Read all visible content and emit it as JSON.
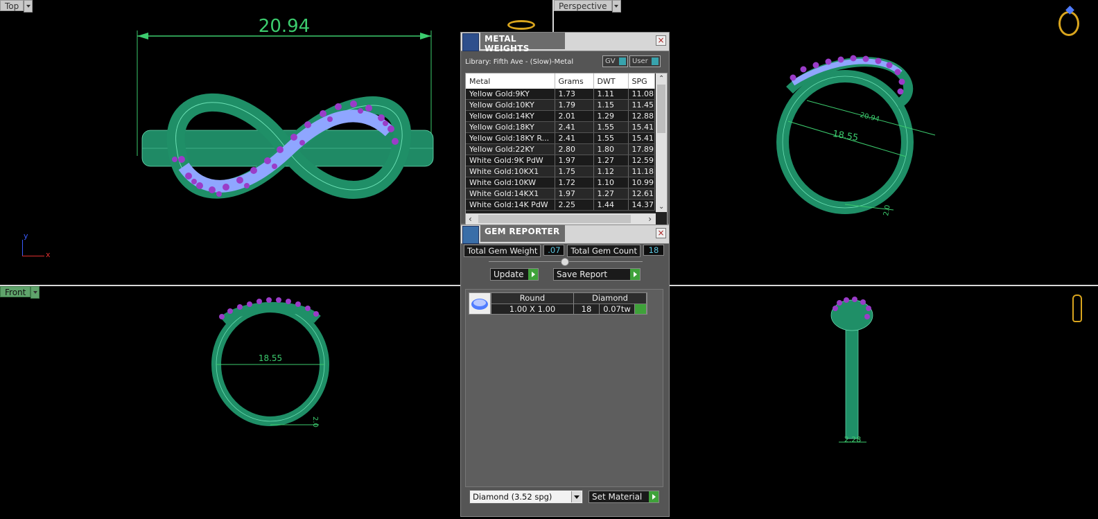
{
  "viewports": {
    "top": {
      "label": "Top",
      "dim_width": "20.94"
    },
    "perspective": {
      "label": "Perspective",
      "dim_width": "20.94",
      "dim_inner": "18.55",
      "dim_small": "2.0"
    },
    "front": {
      "label": "Front",
      "dim_inner": "18.55",
      "dim_small": "2.0"
    },
    "right": {
      "dim_width": "2.28"
    }
  },
  "axes": {
    "y": "y",
    "x": "x"
  },
  "metal_weights": {
    "title": "METAL WEIGHTS",
    "library": "Library: Fifth Ave - (Slow)-Metal",
    "toggle_gv": "GV",
    "toggle_user": "User",
    "columns": [
      "Metal",
      "Grams",
      "DWT",
      "SPG"
    ],
    "rows": [
      [
        "Yellow Gold:9KY",
        "1.73",
        "1.11",
        "11.08"
      ],
      [
        "Yellow Gold:10KY",
        "1.79",
        "1.15",
        "11.45"
      ],
      [
        "Yellow Gold:14KY",
        "2.01",
        "1.29",
        "12.88"
      ],
      [
        "Yellow Gold:18KY",
        "2.41",
        "1.55",
        "15.41"
      ],
      [
        "Yellow Gold:18KY R...",
        "2.41",
        "1.55",
        "15.41"
      ],
      [
        "Yellow Gold:22KY",
        "2.80",
        "1.80",
        "17.89"
      ],
      [
        "White Gold:9K PdW",
        "1.97",
        "1.27",
        "12.59"
      ],
      [
        "White Gold:10KX1",
        "1.75",
        "1.12",
        "11.18"
      ],
      [
        "White Gold:10KW",
        "1.72",
        "1.10",
        "10.99"
      ],
      [
        "White Gold:14KX1",
        "1.97",
        "1.27",
        "12.61"
      ],
      [
        "White Gold:14K PdW",
        "2.25",
        "1.44",
        "14.37"
      ]
    ]
  },
  "gem_reporter": {
    "title": "GEM REPORTER",
    "total_weight_label": "Total Gem Weight",
    "total_weight_value": ".07",
    "total_count_label": "Total Gem Count",
    "total_count_value": "18",
    "update_label": "Update",
    "save_label": "Save Report",
    "gem_columns": [
      "Round",
      "Diamond"
    ],
    "gem_row": {
      "size": "1.00 X 1.00",
      "count": "18",
      "weight": "0.07tw"
    },
    "material_select": "Diamond    (3.52 spg)",
    "set_material_label": "Set Material"
  },
  "colors": {
    "ring": "#1f8f67",
    "gem": "#8fa6ff",
    "prong": "#9a3cc8",
    "dim": "#3ccc6e"
  }
}
